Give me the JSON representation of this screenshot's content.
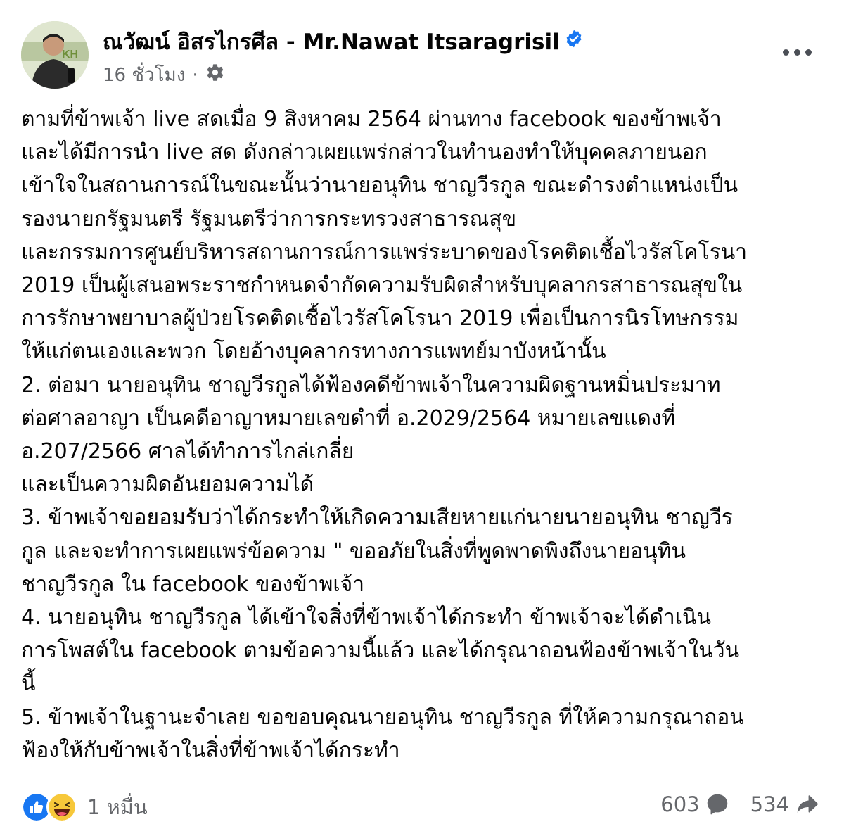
{
  "post": {
    "author": "ณวัฒน์ อิสรไกรศีล - Mr.Nawat Itsaragrisil",
    "time": "16 ชั่วโมง",
    "separator": "·",
    "privacy_icon": "gear-icon",
    "more_icon": "more-horizontal-icon",
    "verified_icon": "verified-badge-icon",
    "accent_color": "#1877f2",
    "body_lines": [
      "ตามที่ข้าพเจ้า live สดเมื่อ 9 สิงหาคม 2564 ผ่านทาง facebook  ของข้าพเจ้า",
      "และได้มีการนำ live สด ดังกล่าวเผยแพร่กล่าวในทำนองทำให้บุคคลภายนอก",
      "เข้าใจในสถานการณ์ในขณะนั้นว่านายอนุทิน ชาญวีรกูล ขณะดำรงตำแหน่งเป็น",
      "รองนายกรัฐมนตรี รัฐมนตรีว่าการกระทรวงสาธารณสุข",
      "และกรรมการศูนย์บริหารสถานการณ์การแพร่ระบาดของโรคติดเชื้อไวรัสโคโรนา",
      "2019 เป็นผู้เสนอพระราชกำหนดจำกัดความรับผิดสำหรับบุคลากรสาธารณสุขใน",
      "การรักษาพยาบาลผู้ป่วยโรคติดเชื้อไวรัสโคโรนา 2019 เพื่อเป็นการนิรโทษกรรม",
      "ให้แก่ตนเองและพวก โดยอ้างบุคลากรทางการแพทย์มาบังหน้านั้น",
      " 2. ต่อมา นายอนุทิน ชาญวีรกูลได้ฟ้องคดีข้าพเจ้าในความผิดฐานหมิ่นประมาท",
      "ต่อศาลอาญา เป็นคดีอาญาหมายเลขดำที่ อ.2029/2564 หมายเลขแดงที่",
      "อ.207/2566  ศาลได้ทำการไกล่เกลี่ย",
      "และเป็นความผิดอันยอมความได้",
      "3. ข้าพเจ้าขอยอมรับว่าได้กระทำให้เกิดความเสียหายแก่นายนายอนุทิน  ชาญวีร",
      "กูล และจะทำการเผยแพร่ข้อความ \" ขออภัยในสิ่งที่พูดพาดพิงถึงนายอนุทิน",
      "ชาญวีรกูล ใน facebook ของข้าพเจ้า",
      "4. นายอนุทิน  ชาญวีรกูล ได้เข้าใจสิ่งที่ข้าพเจ้าได้กระทำ ข้าพเจ้าจะได้ดำเนิน",
      "การโพสต์ใน facebook ตามข้อความนี้แล้ว และได้กรุณาถอนฟ้องข้าพเจ้าในวัน",
      "นี้",
      "5. ข้าพเจ้าในฐานะจำเลย ขอขอบคุณนายอนุทิน ชาญวีรกูล ที่ให้ความกรุณาถอน",
      "ฟ้องให้กับข้าพเจ้าในสิ่งที่ข้าพเจ้าได้กระทำ"
    ]
  },
  "footer": {
    "reaction_icons": [
      "like-icon",
      "haha-icon"
    ],
    "reaction_count": "1 หมื่น",
    "comments": "603",
    "comment_icon": "comment-bubble-icon",
    "shares": "534",
    "share_icon": "share-arrow-icon"
  }
}
